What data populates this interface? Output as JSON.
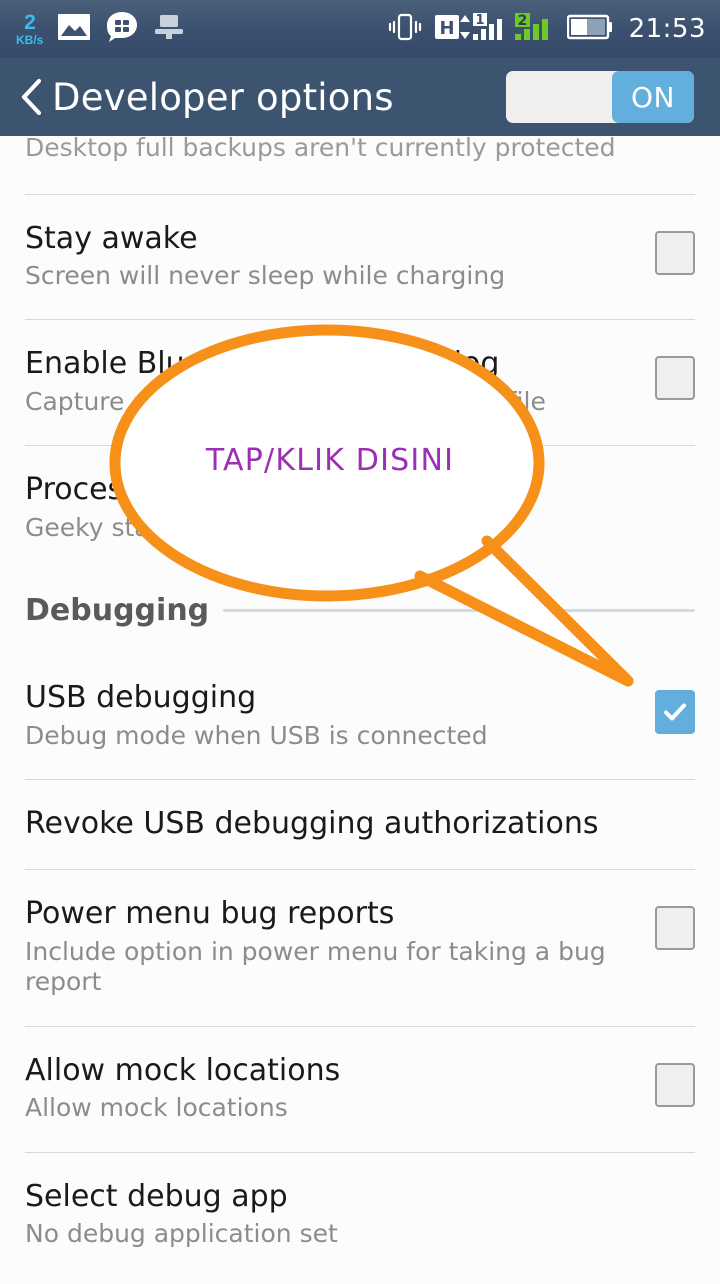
{
  "statusbar": {
    "net_speed_value": "2",
    "net_speed_unit": "KB/s",
    "time": "21:53",
    "icons": [
      "photo-icon",
      "messaging-icon",
      "usb-connected-icon",
      "vibrate-icon",
      "hspa-data-icon",
      "sim1-signal-icon",
      "sim2-signal-icon",
      "battery-icon"
    ],
    "hspa_label": "H",
    "sim1_label": "1",
    "sim2_label": "2"
  },
  "actionbar": {
    "title": "Developer options",
    "back_icon": "back-chevron-icon",
    "master_switch_label": "ON",
    "master_switch_on": true
  },
  "callout": {
    "text": "TAP/KLIK DISINI",
    "color": "#9B2FB5",
    "outline_color": "#F79019"
  },
  "colors": {
    "actionbar_bg": "#3D5471",
    "accent_blue": "#62AEDC",
    "page_bg": "#FCFCFC",
    "divider": "#D9D9D9",
    "title_text": "#1A1A1A",
    "summary_text": "#8C8C8C"
  },
  "list": [
    {
      "kind": "row-clipped",
      "name": "auto-restore-row",
      "title": "",
      "summary": "Desktop full backups aren't currently protected",
      "control": "none"
    },
    {
      "kind": "row",
      "name": "stay-awake-row",
      "title": "Stay awake",
      "summary": "Screen will never sleep while charging",
      "control": "checkbox",
      "checked": false
    },
    {
      "kind": "row",
      "name": "bluetooth-hci-log-row",
      "title": "Enable Bluetooth HCI snoop log",
      "summary": "Capture all bluetooth HCI packets in a file",
      "control": "checkbox",
      "checked": false
    },
    {
      "kind": "row",
      "name": "process-stats-row",
      "title": "Process Stats",
      "summary": "Geeky stats about running processes",
      "control": "none"
    },
    {
      "kind": "section",
      "name": "debugging-section-header",
      "title": "Debugging"
    },
    {
      "kind": "row",
      "name": "usb-debugging-row",
      "title": "USB debugging",
      "summary": "Debug mode when USB is connected",
      "control": "checkbox",
      "checked": true
    },
    {
      "kind": "row",
      "name": "revoke-usb-authorizations-row",
      "title": "Revoke USB debugging authorizations",
      "summary": "",
      "control": "none"
    },
    {
      "kind": "row",
      "name": "power-menu-bug-reports-row",
      "title": "Power menu bug reports",
      "summary": "Include option in power menu for taking a bug report",
      "control": "checkbox",
      "checked": false
    },
    {
      "kind": "row",
      "name": "allow-mock-locations-row",
      "title": "Allow mock locations",
      "summary": "Allow mock locations",
      "control": "checkbox",
      "checked": false
    },
    {
      "kind": "row",
      "name": "select-debug-app-row",
      "title": "Select debug app",
      "summary": "No debug application set",
      "control": "none"
    }
  ]
}
